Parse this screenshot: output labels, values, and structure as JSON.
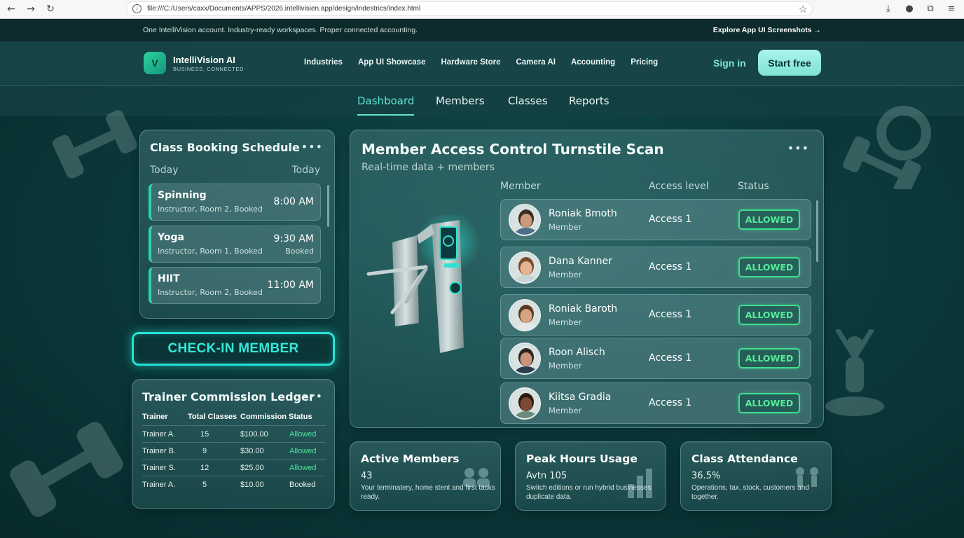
{
  "browser": {
    "url": "file:///C:/Users/caxx/Documents/APPS/2026.intellivisien.app/design/indestrics/index.html"
  },
  "announcement": {
    "left_text": "One IntelliVision account. Industry-ready workspaces. Proper connected accounting.",
    "right_link": "Explore App UI Screenshots →"
  },
  "header": {
    "logo_letter": "V",
    "brand_name": "IntelliVision AI",
    "brand_tagline": "BUSINESS, CONNECTED",
    "nav": [
      "Industries",
      "App UI Showcase",
      "Hardware Store",
      "Camera AI",
      "Accounting",
      "Pricing"
    ],
    "sign_in": "Sign in",
    "start_free": "Start free"
  },
  "subtabs": {
    "items": [
      "Dashboard",
      "Members",
      "Classes",
      "Reports"
    ],
    "active": "Dashboard"
  },
  "class_booking": {
    "title": "Class Booking Schedule",
    "menu": "•••",
    "day_left": "Today",
    "day_right": "Today",
    "classes": [
      {
        "name": "Spinning",
        "detail": "Instructor, Room 2, Booked",
        "time": "8:00 AM",
        "status": ""
      },
      {
        "name": "Yoga",
        "detail": "Instructor, Room 1, Booked",
        "time": "9:30 AM",
        "status": "Booked"
      },
      {
        "name": "HIIT",
        "detail": "Instructor, Room 2, Booked",
        "time": "11:00 AM",
        "status": ""
      }
    ]
  },
  "checkin": {
    "label": "CHECK-IN MEMBER"
  },
  "ledger": {
    "title": "Trainer Commission Ledger",
    "menu": "•••",
    "columns": [
      "Trainer",
      "Total Classes",
      "Commission",
      "Status"
    ],
    "rows": [
      {
        "trainer": "Trainer A.",
        "classes": "15",
        "commission": "$100.00",
        "status": "Allowed"
      },
      {
        "trainer": "Trainer  B.",
        "classes": "9",
        "commission": "$30.00",
        "status": "Allowed"
      },
      {
        "trainer": "Trainer  S.",
        "classes": "12",
        "commission": "$25.00",
        "status": "Allowed"
      },
      {
        "trainer": "Trainer  A.",
        "classes": "5",
        "commission": "$10.00",
        "status": "Booked"
      }
    ]
  },
  "access_control": {
    "title": "Member Access Control Turnstile Scan",
    "subtitle": "Real-time data + members",
    "menu": "•••",
    "columns": [
      "Member",
      "Access level",
      "Status"
    ],
    "members": [
      {
        "name": "Roniak Bmoth",
        "role": "Member",
        "access": "Access 1",
        "status": "ALLOWED",
        "skin": "#c99a78",
        "hair": "#3a2a22",
        "shirt": "#4d6f8a"
      },
      {
        "name": "Dana Kanner",
        "role": "Member",
        "access": "Access 1",
        "status": "ALLOWED",
        "skin": "#e3b596",
        "hair": "#7a4a2a",
        "shirt": "#c9d4d8"
      },
      {
        "name": "Roniak Baroth",
        "role": "Member",
        "access": "Access 1",
        "status": "ALLOWED",
        "skin": "#d6a481",
        "hair": "#5a3a24",
        "shirt": "#e5e9ea"
      },
      {
        "name": "Roon Alisch",
        "role": "Member",
        "access": "Access 1",
        "status": "ALLOWED",
        "skin": "#c8957a",
        "hair": "#2d2420",
        "shirt": "#2d3d4d"
      },
      {
        "name": "Kiitsa Gradia",
        "role": "Member",
        "access": "Access 1",
        "status": "ALLOWED",
        "skin": "#7a4b32",
        "hair": "#2a1a12",
        "shirt": "#6a8a7a"
      }
    ]
  },
  "stats": [
    {
      "title": "Active Members",
      "value": "43",
      "desc": "Your terminatery, home stent and first tasks ready."
    },
    {
      "title": "Peak Hours Usage",
      "value": "Avtn 105",
      "desc": "Switch editions or run hybrid businesses duplicate data."
    },
    {
      "title": "Class Attendance",
      "value": "36.5%",
      "desc": "Operations, tax, stock, customers and together."
    }
  ],
  "colors": {
    "accent": "#5fe4cf",
    "neon": "#26e2d6",
    "allowed": "#4ee19a"
  }
}
